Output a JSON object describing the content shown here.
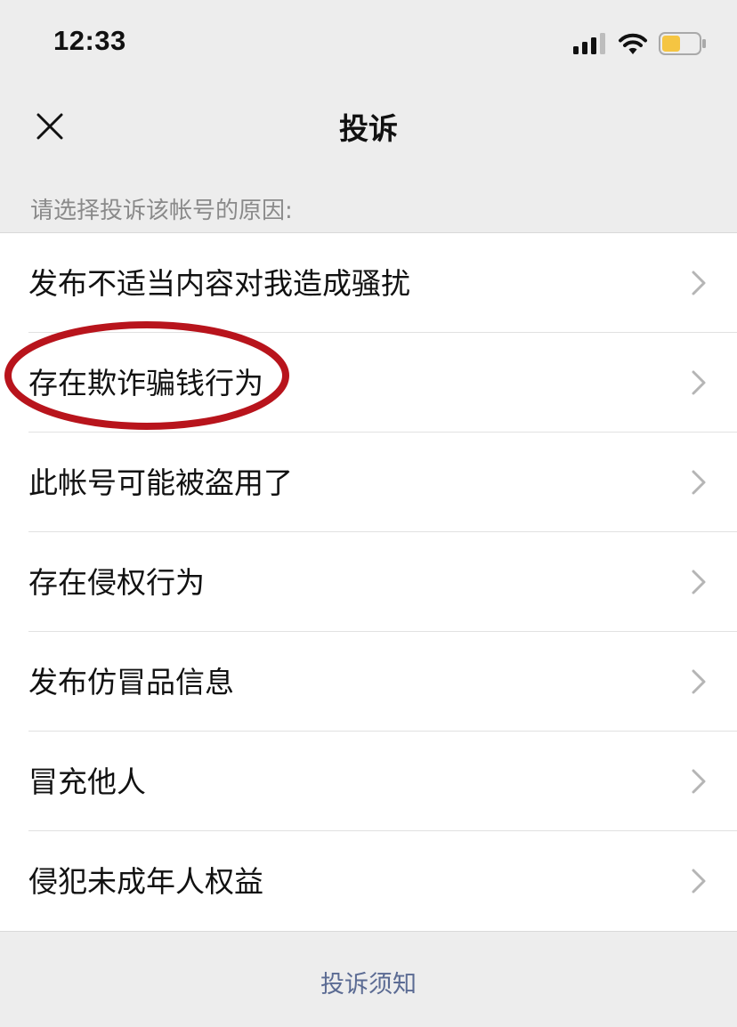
{
  "status_bar": {
    "time": "12:33",
    "icons": [
      "cellular-signal-icon",
      "wifi-icon",
      "battery-icon"
    ],
    "battery_color": "#f5c542"
  },
  "nav": {
    "title": "投诉",
    "close_icon": "close-icon"
  },
  "section_header": "请选择投诉该帐号的原因:",
  "reasons": [
    {
      "label": "发布不适当内容对我造成骚扰"
    },
    {
      "label": "存在欺诈骗钱行为",
      "highlighted": true
    },
    {
      "label": "此帐号可能被盗用了"
    },
    {
      "label": "存在侵权行为"
    },
    {
      "label": "发布仿冒品信息"
    },
    {
      "label": "冒充他人"
    },
    {
      "label": "侵犯未成年人权益"
    }
  ],
  "footer": {
    "link_label": "投诉须知",
    "link_color": "#5b6b93"
  },
  "colors": {
    "background": "#ededed",
    "list_background": "#ffffff",
    "highlight_oval": "#b8141c"
  }
}
